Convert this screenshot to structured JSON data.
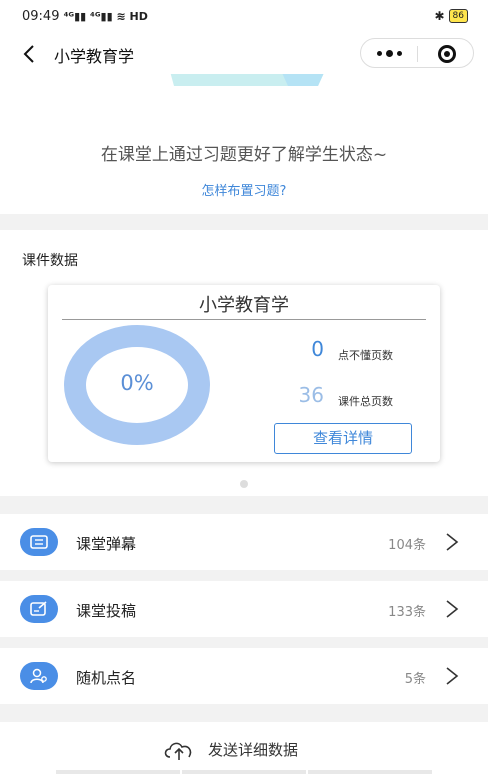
{
  "status": {
    "time": "09:49",
    "signal": "⁴ᴳ⁴ᴳ ≋ HD",
    "battery": "86"
  },
  "nav": {
    "title": "小学教育学"
  },
  "intro": {
    "hint": "在课堂上通过习题更好了解学生状态~",
    "link": "怎样布置习题?"
  },
  "courseware": {
    "section_title": "课件数据",
    "card_title": "小学教育学",
    "percent": "0%",
    "percent_value": 0,
    "unclear_pages": "0",
    "unclear_label": "点不懂页数",
    "total_pages": "36",
    "total_label": "课件总页数",
    "details_button": "查看详情"
  },
  "rows": [
    {
      "label": "课堂弹幕",
      "count": "104条",
      "icon": "danmaku-icon"
    },
    {
      "label": "课堂投稿",
      "count": "133条",
      "icon": "submission-icon"
    },
    {
      "label": "随机点名",
      "count": "5条",
      "icon": "roll-call-icon"
    }
  ],
  "bottom": {
    "send_label": "发送详细数据"
  },
  "colors": {
    "accent": "#3f87d9",
    "donut": "#a9c8f2",
    "icon_bg": "#4a8ee6"
  }
}
